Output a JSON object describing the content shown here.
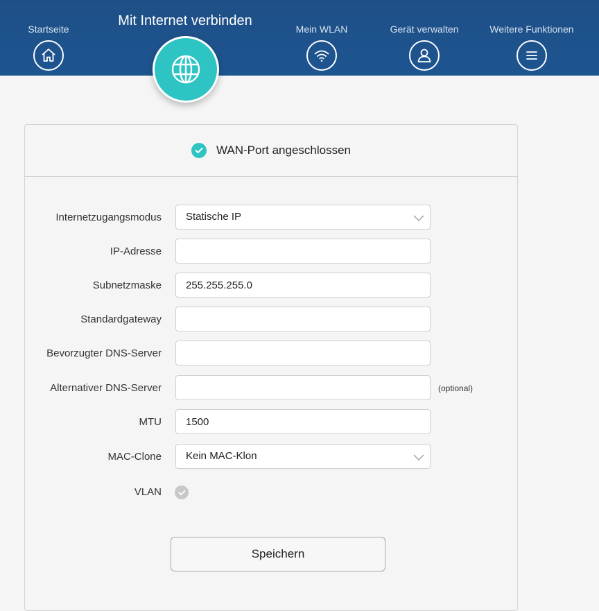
{
  "nav": {
    "items": [
      {
        "label": "Startseite",
        "icon": "home-icon"
      },
      {
        "label": "Mit Internet verbinden",
        "icon": "globe-icon",
        "active": true
      },
      {
        "label": "Mein WLAN",
        "icon": "wifi-icon"
      },
      {
        "label": "Gerät verwalten",
        "icon": "user-icon"
      },
      {
        "label": "Weitere Funktionen",
        "icon": "menu-icon"
      }
    ]
  },
  "status": {
    "text": "WAN-Port angeschlossen",
    "icon": "check-circle-icon"
  },
  "form": {
    "access_mode": {
      "label": "Internetzugangsmodus",
      "value": "Statische IP"
    },
    "ip_address": {
      "label": "IP-Adresse",
      "value": ""
    },
    "subnet_mask": {
      "label": "Subnetzmaske",
      "value": "255.255.255.0"
    },
    "gateway": {
      "label": "Standardgateway",
      "value": ""
    },
    "dns_primary": {
      "label": "Bevorzugter DNS-Server",
      "value": ""
    },
    "dns_alternate": {
      "label": "Alternativer DNS-Server",
      "value": "",
      "hint": "(optional)"
    },
    "mtu": {
      "label": "MTU",
      "value": "1500"
    },
    "mac_clone": {
      "label": "MAC-Clone",
      "value": "Kein MAC-Klon"
    },
    "vlan": {
      "label": "VLAN",
      "checked": false
    }
  },
  "actions": {
    "save_label": "Speichern"
  },
  "colors": {
    "header": "#1d5591",
    "accent": "#2ec4c4",
    "background": "#f5f5f5"
  }
}
